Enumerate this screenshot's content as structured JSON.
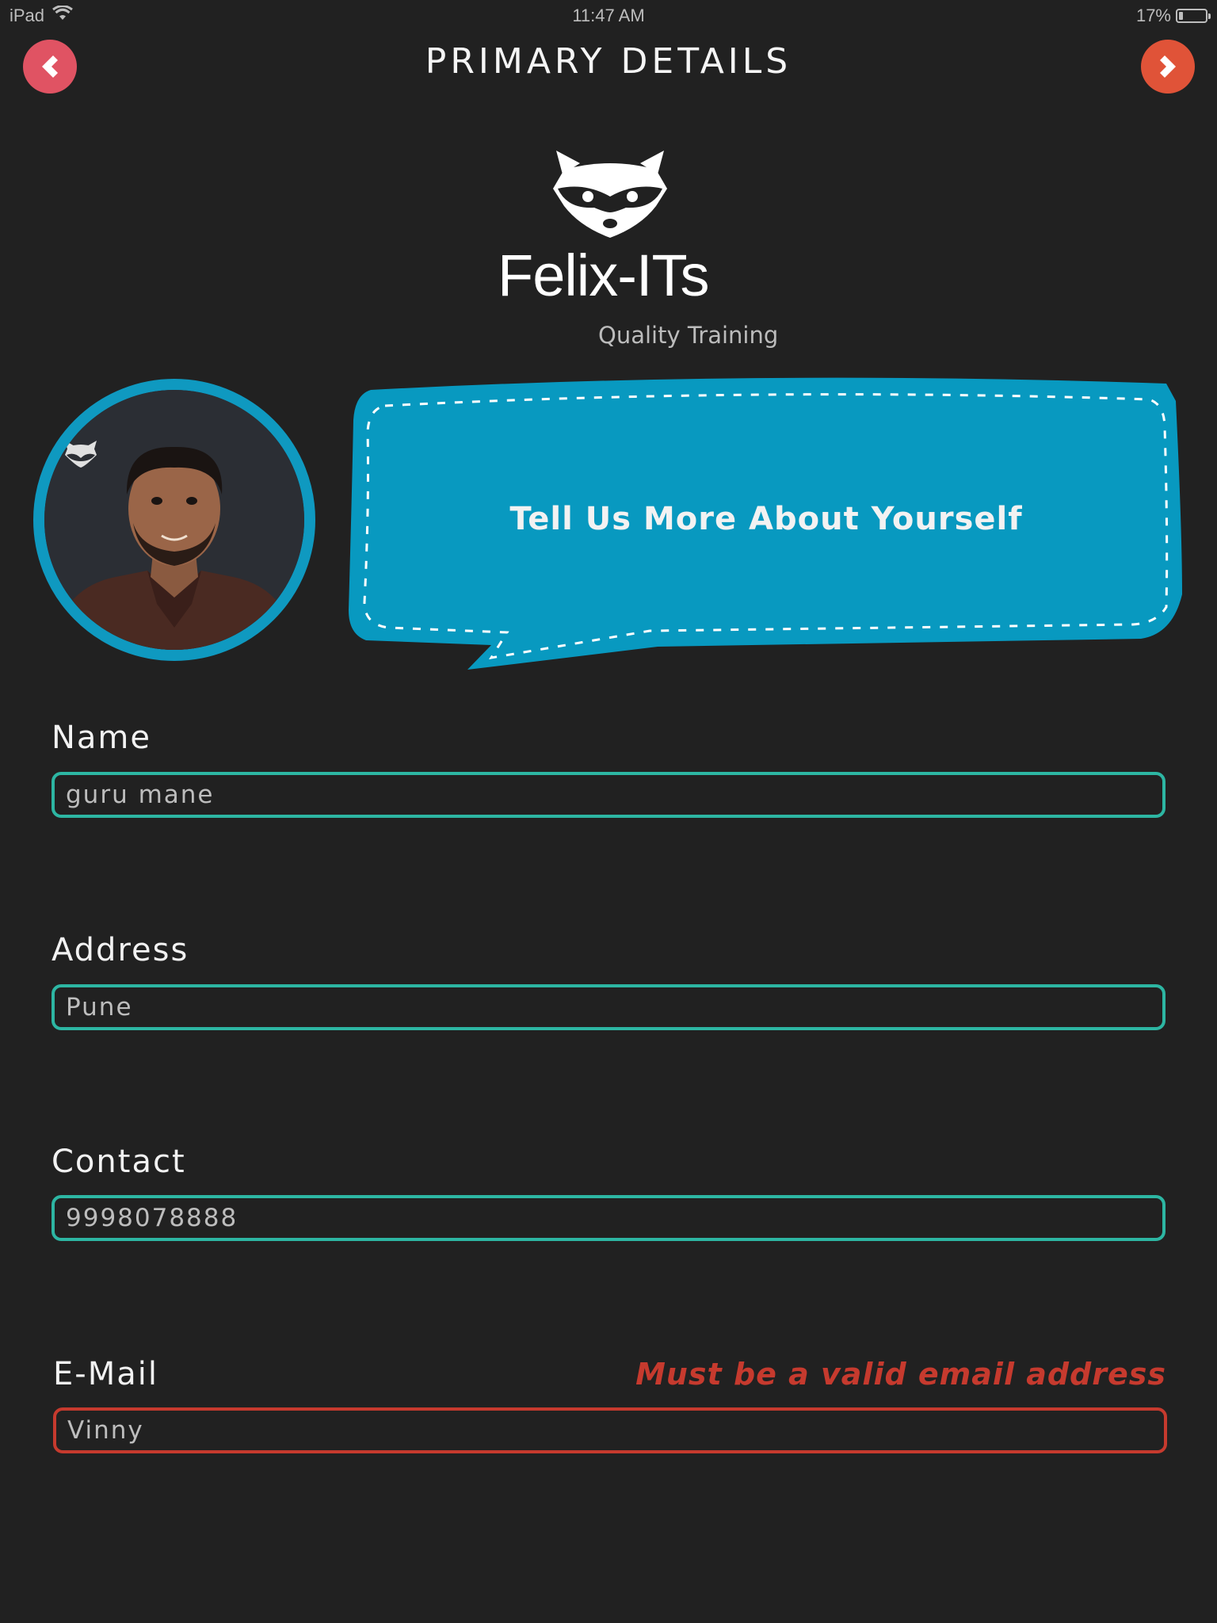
{
  "status_bar": {
    "device": "iPad",
    "time": "11:47 AM",
    "battery_percent": "17%",
    "battery_level": 0.17,
    "wifi_icon": "wifi-icon"
  },
  "header": {
    "title": "PRIMARY DETAILS",
    "back_icon": "chevron-left-icon",
    "next_icon": "chevron-right-icon"
  },
  "logo": {
    "name": "Felix-ITs",
    "tagline": "Quality Training",
    "icon": "raccoon-icon"
  },
  "profile": {
    "avatar_icon": "user-photo",
    "bubble_text": "Tell Us More About Yourself"
  },
  "form": {
    "name": {
      "label": "Name",
      "value": "guru mane"
    },
    "address": {
      "label": "Address",
      "value": "Pune"
    },
    "contact": {
      "label": "Contact",
      "value": "9998078888"
    },
    "email": {
      "label": "E-Mail",
      "value": "Vinny",
      "error": "Must be a valid email address"
    }
  },
  "colors": {
    "background": "#212121",
    "accent": "#0f99c0",
    "input_border": "#2db6a3",
    "error": "#c63a2e",
    "back_button": "#e05363",
    "next_button": "#e05338"
  }
}
